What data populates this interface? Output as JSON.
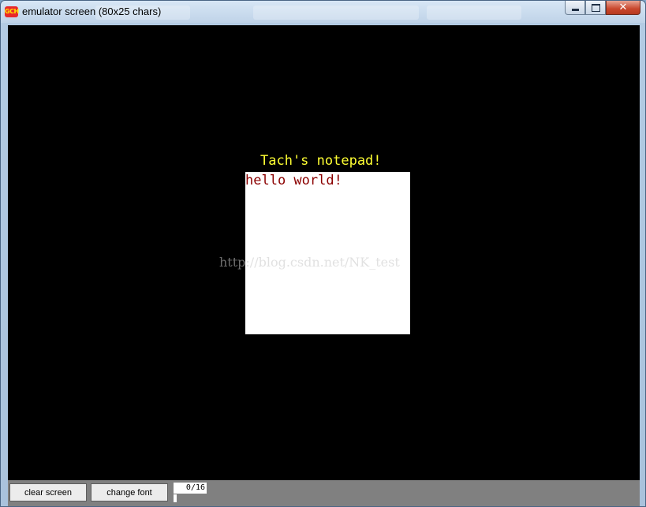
{
  "window": {
    "title": "emulator screen (80x25 chars)",
    "icon_label": "GCH",
    "caption_buttons": [
      "minimize-icon",
      "maximize-icon",
      "close-icon"
    ],
    "close_glyph": "✕"
  },
  "screen": {
    "notepad_title": "Tach's notepad!",
    "notepad_text": "hello world!",
    "watermark": "http://blog.csdn.net/NK_test",
    "colors": {
      "background": "#000000",
      "title": "#ffff33",
      "text": "#8b0000",
      "notepad_bg": "#ffffff"
    }
  },
  "controls": {
    "clear_label": "clear screen",
    "font_label": "change font",
    "counter": "0/16",
    "counter_fill": 0
  }
}
